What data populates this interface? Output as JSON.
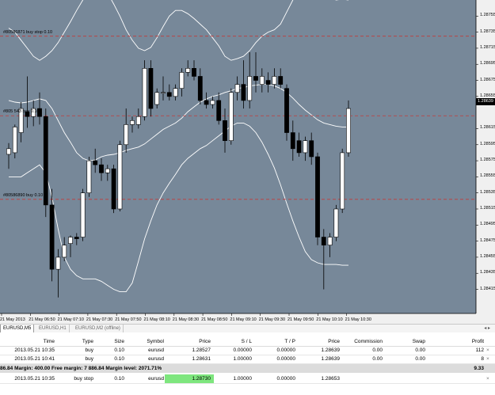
{
  "chart": {
    "background": "#778899",
    "bb_color": "#ffffff",
    "order_line_color": "#c23b3b",
    "candles": [
      {
        "o": 1.28583,
        "h": 1.28597,
        "l": 1.28565,
        "c": 1.2859
      },
      {
        "o": 1.28585,
        "h": 1.2862,
        "l": 1.28578,
        "c": 1.28617
      },
      {
        "o": 1.2861,
        "h": 1.28648,
        "l": 1.28598,
        "c": 1.2864
      },
      {
        "o": 1.28636,
        "h": 1.2868,
        "l": 1.28616,
        "c": 1.2863
      },
      {
        "o": 1.2863,
        "h": 1.2865,
        "l": 1.28618,
        "c": 1.2864
      },
      {
        "o": 1.2864,
        "h": 1.2866,
        "l": 1.2862,
        "c": 1.2863
      },
      {
        "o": 1.2863,
        "h": 1.2864,
        "l": 1.28505,
        "c": 1.2852
      },
      {
        "o": 1.2852,
        "h": 1.2854,
        "l": 1.28425,
        "c": 1.2844
      },
      {
        "o": 1.2844,
        "h": 1.28465,
        "l": 1.28405,
        "c": 1.28455
      },
      {
        "o": 1.28455,
        "h": 1.2848,
        "l": 1.2845,
        "c": 1.2847
      },
      {
        "o": 1.28472,
        "h": 1.28482,
        "l": 1.28455,
        "c": 1.2848
      },
      {
        "o": 1.2848,
        "h": 1.28485,
        "l": 1.2847,
        "c": 1.28478
      },
      {
        "o": 1.2848,
        "h": 1.2854,
        "l": 1.28475,
        "c": 1.28535
      },
      {
        "o": 1.28535,
        "h": 1.2858,
        "l": 1.2853,
        "c": 1.28575
      },
      {
        "o": 1.28575,
        "h": 1.2859,
        "l": 1.2856,
        "c": 1.2857
      },
      {
        "o": 1.2857,
        "h": 1.28578,
        "l": 1.2855,
        "c": 1.2856
      },
      {
        "o": 1.2856,
        "h": 1.2857,
        "l": 1.2855,
        "c": 1.28565
      },
      {
        "o": 1.28565,
        "h": 1.2857,
        "l": 1.2851,
        "c": 1.28515
      },
      {
        "o": 1.28515,
        "h": 1.286,
        "l": 1.28512,
        "c": 1.28595
      },
      {
        "o": 1.28595,
        "h": 1.2864,
        "l": 1.28585,
        "c": 1.2862
      },
      {
        "o": 1.2862,
        "h": 1.2863,
        "l": 1.2861,
        "c": 1.28625
      },
      {
        "o": 1.2862,
        "h": 1.2864,
        "l": 1.28615,
        "c": 1.2863
      },
      {
        "o": 1.2863,
        "h": 1.287,
        "l": 1.28625,
        "c": 1.2869
      },
      {
        "o": 1.2869,
        "h": 1.287,
        "l": 1.2863,
        "c": 1.2864
      },
      {
        "o": 1.28645,
        "h": 1.28665,
        "l": 1.2864,
        "c": 1.2866
      },
      {
        "o": 1.2866,
        "h": 1.2868,
        "l": 1.2865,
        "c": 1.2866
      },
      {
        "o": 1.2866,
        "h": 1.2867,
        "l": 1.2865,
        "c": 1.28655
      },
      {
        "o": 1.28655,
        "h": 1.2867,
        "l": 1.2865,
        "c": 1.28665
      },
      {
        "o": 1.28665,
        "h": 1.2869,
        "l": 1.28655,
        "c": 1.28685
      },
      {
        "o": 1.28685,
        "h": 1.287,
        "l": 1.2868,
        "c": 1.2869
      },
      {
        "o": 1.2869,
        "h": 1.287,
        "l": 1.28675,
        "c": 1.2868
      },
      {
        "o": 1.2868,
        "h": 1.2869,
        "l": 1.28645,
        "c": 1.2865
      },
      {
        "o": 1.2865,
        "h": 1.2866,
        "l": 1.2864,
        "c": 1.28645
      },
      {
        "o": 1.28645,
        "h": 1.28655,
        "l": 1.2864,
        "c": 1.2865
      },
      {
        "o": 1.2865,
        "h": 1.2866,
        "l": 1.2862,
        "c": 1.28625
      },
      {
        "o": 1.28625,
        "h": 1.2864,
        "l": 1.28585,
        "c": 1.286
      },
      {
        "o": 1.286,
        "h": 1.28665,
        "l": 1.28595,
        "c": 1.2866
      },
      {
        "o": 1.2866,
        "h": 1.2868,
        "l": 1.2865,
        "c": 1.2867
      },
      {
        "o": 1.2867,
        "h": 1.287,
        "l": 1.2864,
        "c": 1.2865
      },
      {
        "o": 1.2865,
        "h": 1.2871,
        "l": 1.2864,
        "c": 1.2868
      },
      {
        "o": 1.2868,
        "h": 1.2871,
        "l": 1.2866,
        "c": 1.28675
      },
      {
        "o": 1.2867,
        "h": 1.2869,
        "l": 1.2866,
        "c": 1.2868
      },
      {
        "o": 1.28675,
        "h": 1.28685,
        "l": 1.2866,
        "c": 1.2867
      },
      {
        "o": 1.2867,
        "h": 1.2869,
        "l": 1.28665,
        "c": 1.2868
      },
      {
        "o": 1.2868,
        "h": 1.2869,
        "l": 1.28665,
        "c": 1.2867
      },
      {
        "o": 1.28665,
        "h": 1.2867,
        "l": 1.286,
        "c": 1.2861
      },
      {
        "o": 1.2861,
        "h": 1.28625,
        "l": 1.28575,
        "c": 1.2859
      },
      {
        "o": 1.286,
        "h": 1.2861,
        "l": 1.2858,
        "c": 1.28585
      },
      {
        "o": 1.28585,
        "h": 1.28605,
        "l": 1.28575,
        "c": 1.286
      },
      {
        "o": 1.286,
        "h": 1.2861,
        "l": 1.2857,
        "c": 1.2858
      },
      {
        "o": 1.2858,
        "h": 1.28585,
        "l": 1.2847,
        "c": 1.2848
      },
      {
        "o": 1.2848,
        "h": 1.2849,
        "l": 1.28415,
        "c": 1.2847
      },
      {
        "o": 1.2847,
        "h": 1.28485,
        "l": 1.28455,
        "c": 1.2848
      },
      {
        "o": 1.2848,
        "h": 1.2852,
        "l": 1.28475,
        "c": 1.28515
      },
      {
        "o": 1.28515,
        "h": 1.2859,
        "l": 1.2851,
        "c": 1.28585
      },
      {
        "o": 1.28585,
        "h": 1.2865,
        "l": 1.2858,
        "c": 1.2864
      }
    ],
    "bb_upper": [
      1.2874,
      1.28735,
      1.28725,
      1.28715,
      1.28705,
      1.287,
      1.28705,
      1.28712,
      1.28722,
      1.28735,
      1.28748,
      1.28762,
      1.28775,
      1.28785,
      1.28792,
      1.28792,
      1.28784,
      1.2877,
      1.28755,
      1.28738,
      1.28725,
      1.28715,
      1.28712,
      1.28716,
      1.28728,
      1.28742,
      1.28755,
      1.28762,
      1.28762,
      1.28758,
      1.28752,
      1.28745,
      1.28738,
      1.28728,
      1.28718,
      1.28705,
      1.287,
      1.28702,
      1.28705,
      1.28712,
      1.28722,
      1.2873,
      1.28735,
      1.28738,
      1.28745,
      1.2876,
      1.28775,
      1.28785,
      1.28793,
      1.28798,
      1.28795,
      1.28785,
      1.28778,
      1.28775,
      1.28776,
      1.28775
    ],
    "bb_middle": [
      1.2865,
      1.28648,
      1.28647,
      1.28648,
      1.2865,
      1.28652,
      1.2865,
      1.2864,
      1.28625,
      1.2861,
      1.28598,
      1.28585,
      1.28578,
      1.28575,
      1.28576,
      1.2858,
      1.28582,
      1.28583,
      1.28585,
      1.28588,
      1.2859,
      1.28592,
      1.28596,
      1.28602,
      1.28608,
      1.28614,
      1.28618,
      1.28622,
      1.28628,
      1.28636,
      1.28642,
      1.28648,
      1.28652,
      1.28655,
      1.28657,
      1.2866,
      1.28662,
      1.28665,
      1.28666,
      1.28668,
      1.28669,
      1.2867,
      1.2867,
      1.28668,
      1.28665,
      1.2866,
      1.28653,
      1.28645,
      1.28638,
      1.28632,
      1.28626,
      1.28622,
      1.2862,
      1.28618,
      1.28617,
      1.28617
    ],
    "bb_lower": [
      1.28555,
      1.28555,
      1.28555,
      1.2856,
      1.28565,
      1.2857,
      1.2856,
      1.2853,
      1.2849,
      1.28455,
      1.2844,
      1.28432,
      1.28428,
      1.28428,
      1.28428,
      1.28425,
      1.2842,
      1.28415,
      1.28412,
      1.28412,
      1.28423,
      1.2845,
      1.28478,
      1.285,
      1.2852,
      1.28535,
      1.28547,
      1.28558,
      1.2857,
      1.28578,
      1.28584,
      1.2859,
      1.28594,
      1.286,
      1.28606,
      1.28612,
      1.28618,
      1.28622,
      1.28622,
      1.28618,
      1.2861,
      1.28598,
      1.28583,
      1.28566,
      1.28545,
      1.28522,
      1.285,
      1.2848,
      1.28462,
      1.28452,
      1.28448,
      1.28446,
      1.28446,
      1.28446,
      1.28445,
      1.28445
    ],
    "order_lines": [
      {
        "price": 1.2873,
        "label": "#80586871 buy stop 0.10"
      },
      {
        "price": 1.28631,
        "label": "#805  543 buy 0.10"
      },
      {
        "price": 1.28527,
        "label": "#80586890 buy 0.10"
      }
    ],
    "price_labels": [
      "1.28755",
      "1.28735",
      "1.28715",
      "1.28695",
      "1.28675",
      "1.28655",
      "1.28615",
      "1.28595",
      "1.28575",
      "1.28555",
      "1.28535",
      "1.28515",
      "1.28495",
      "1.28475",
      "1.28455",
      "1.28435",
      "1.28415"
    ],
    "current_price": "1.28639",
    "time_labels": [
      "21 May 2013",
      "21 May 06:50",
      "21 May 07:10",
      "21 May 07:30",
      "21 May 07:50",
      "21 May 08:10",
      "21 May 08:30",
      "21 May 08:50",
      "21 May 09:10",
      "21 May 09:30",
      "21 May 09:50",
      "21 May 10:10",
      "21 May 10:30"
    ]
  },
  "tabs": [
    "EURUSD,M5",
    "EURUSD,H1",
    "EURUSD,M2 (offline)"
  ],
  "table": {
    "headers": {
      "time": "Time",
      "type": "Type",
      "size": "Size",
      "symbol": "Symbol",
      "price": "Price",
      "sl": "S / L",
      "tp": "T / P",
      "price2": "Price",
      "commission": "Commission",
      "swap": "Swap",
      "profit": "Profit"
    },
    "positions": [
      {
        "time": "2013.05.21 10:35",
        "type": "buy",
        "size": "0.10",
        "symbol": "eurusd",
        "price": "1.28527",
        "sl": "0.00000",
        "tp": "0.00000",
        "price2": "1.28639",
        "commission": "0.00",
        "swap": "0.00",
        "profit": "112"
      },
      {
        "time": "2013.05.21 10:41",
        "type": "buy",
        "size": "0.10",
        "symbol": "eurusd",
        "price": "1.28631",
        "sl": "1.00000",
        "tp": "0.00000",
        "price2": "1.28639",
        "commission": "0.00",
        "swap": "0.00",
        "profit": "8"
      }
    ],
    "summary": {
      "text": "86.84  Margin: 400.00  Free margin: 7 886.84  Margin level: 2071.71%",
      "profit": "9.33"
    },
    "orders": [
      {
        "time": "2013.05.21 10:35",
        "type": "buy stop",
        "size": "0.10",
        "symbol": "eurusd",
        "price": "1.28730",
        "sl": "1.00000",
        "tp": "0.00000",
        "price2": "1.28653"
      }
    ],
    "close_glyph": "×",
    "scroll_glyph": "◂ ▸"
  }
}
